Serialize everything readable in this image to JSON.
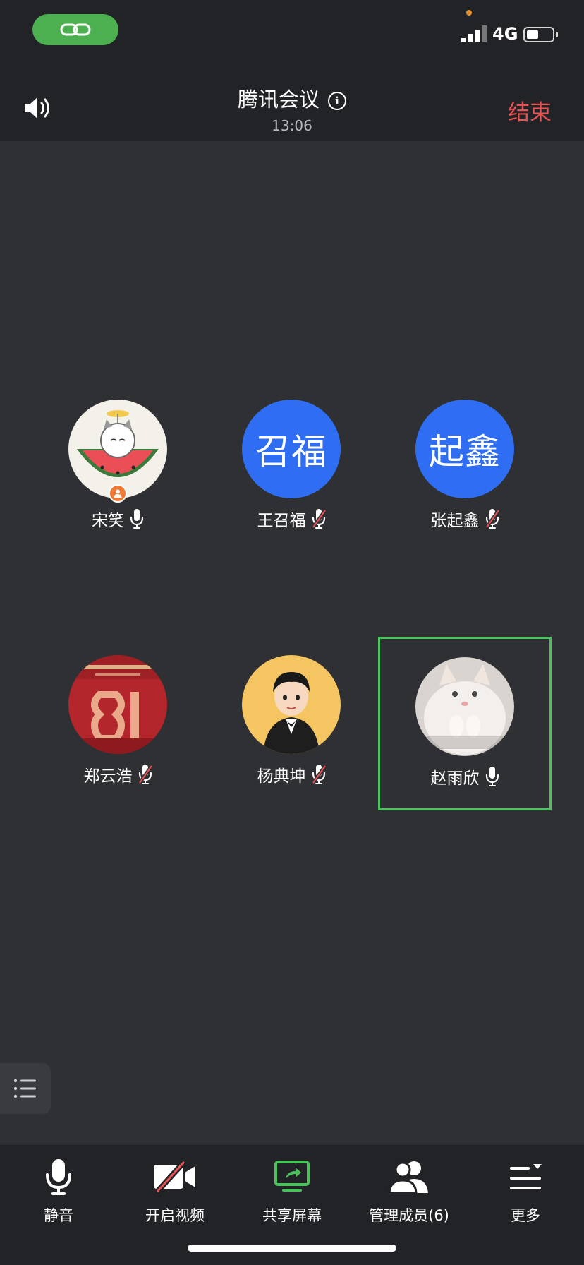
{
  "status_bar": {
    "network": "4G",
    "link_icon": "link-icon",
    "signal_icon": "signal-icon",
    "battery_icon": "battery-icon",
    "battery_level": 0.45
  },
  "header": {
    "title": "腾讯会议",
    "time": "13:06",
    "end_label": "结束",
    "end_color": "#e95353",
    "speaker_icon": "speaker-icon",
    "info_icon": "info-icon"
  },
  "participants": [
    {
      "name": "宋笑",
      "avatar_type": "image",
      "avatar_desc": "cat-in-watermelon",
      "is_host": true,
      "mic": "on",
      "active": false
    },
    {
      "name": "王召福",
      "avatar_type": "text",
      "avatar_text": "召福",
      "is_host": false,
      "mic": "muted",
      "active": false
    },
    {
      "name": "张起鑫",
      "avatar_type": "text",
      "avatar_text": "起鑫",
      "is_host": false,
      "mic": "muted",
      "active": false
    },
    {
      "name": "郑云浩",
      "avatar_type": "image",
      "avatar_desc": "red-81-poster",
      "is_host": false,
      "mic": "muted",
      "active": false
    },
    {
      "name": "杨典坤",
      "avatar_type": "image",
      "avatar_desc": "cartoon-man-tuxedo",
      "is_host": false,
      "mic": "muted",
      "active": false
    },
    {
      "name": "赵雨欣",
      "avatar_type": "image",
      "avatar_desc": "white-kitten",
      "is_host": false,
      "mic": "on",
      "active": true
    }
  ],
  "toolbar": {
    "mute_label": "静音",
    "video_label": "开启视频",
    "share_label": "共享屏幕",
    "members_label": "管理成员(6)",
    "more_label": "更多",
    "accent": "#4cc25c"
  },
  "colors": {
    "avatar_blue": "#2f6ef2",
    "active_border": "#4cc25c",
    "host_badge": "#f07a33"
  }
}
